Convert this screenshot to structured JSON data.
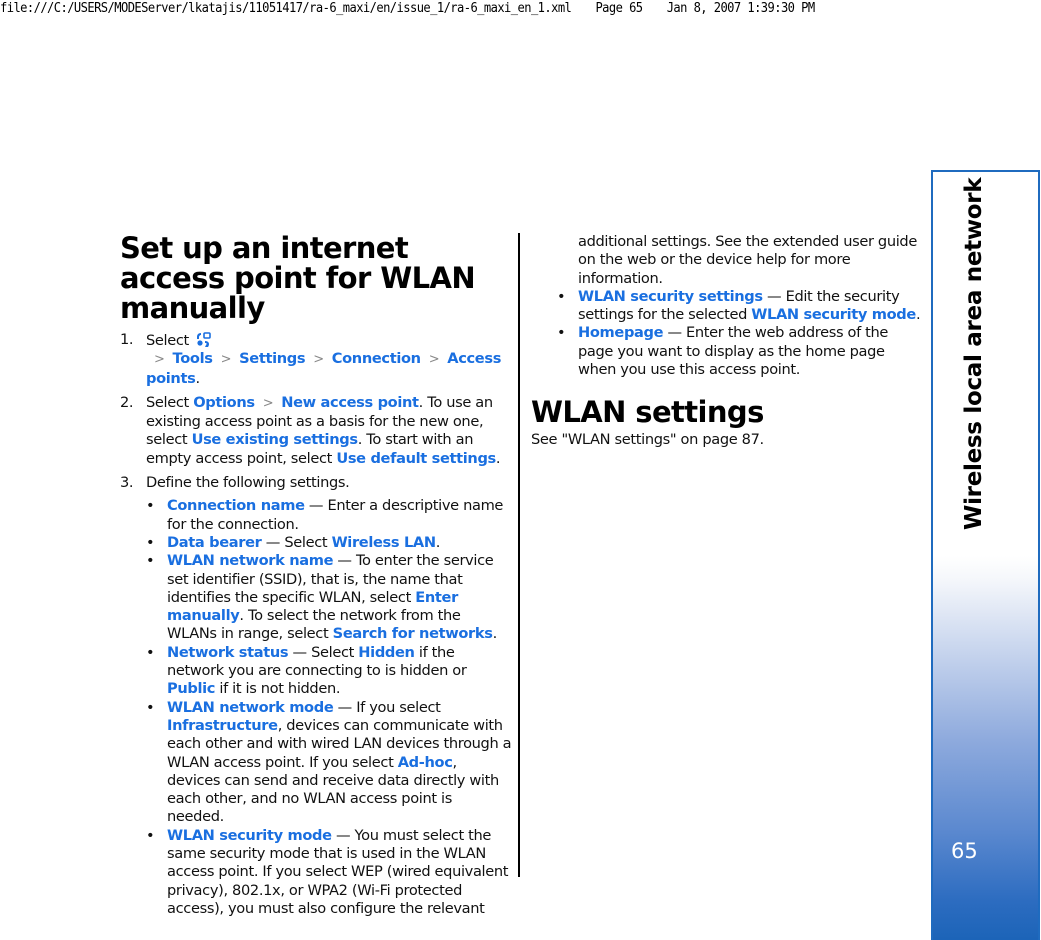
{
  "print_header": {
    "path": "file:///C:/USERS/MODEServer/lkatajis/11051417/ra-6_maxi/en/issue_1/ra-6_maxi_en_1.xml",
    "page": "Page 65",
    "datetime": "Jan 8, 2007 1:39:30 PM"
  },
  "section_tab": {
    "title": "Wireless local area network",
    "page_number": "65",
    "accent_color": "#1f6bbf"
  },
  "link_color": "#1a6fe0",
  "left": {
    "heading": "Set up an internet access point for WLAN manually",
    "step1": {
      "num": "1.",
      "select": "Select",
      "icon": "menu-apps-icon",
      "path": [
        "Tools",
        "Settings",
        "Connection",
        "Access points"
      ],
      "end": "."
    },
    "step2": {
      "num": "2.",
      "select": "Select",
      "path": [
        "Options",
        "New access point"
      ],
      "t1": ". To use an existing access point as a basis for the new one, select",
      "l1": "Use existing settings",
      "t2": ". To start with an empty access point, select",
      "l2": "Use default settings",
      "t3": "."
    },
    "step3": {
      "num": "3.",
      "text": "Define the following settings."
    },
    "bullets": [
      {
        "term": "Connection name",
        "text": " — Enter a descriptive name for the connection."
      },
      {
        "term": "Data bearer",
        "text": " — Select ",
        "l1": "Wireless LAN",
        "t2": "."
      },
      {
        "term": "WLAN network name",
        "text": " — To enter the service set identifier (SSID), that is, the name that identifies the specific WLAN, select ",
        "l1": "Enter manually",
        "t2": ". To select the network from the WLANs in range, select ",
        "l2": "Search for networks",
        "t3": "."
      },
      {
        "term": "Network status",
        "text": " — Select ",
        "l1": "Hidden",
        "t2": " if the network you are connecting to is hidden or ",
        "l2": "Public",
        "t3": " if it is not hidden."
      },
      {
        "term": "WLAN network mode",
        "text": " — If you select ",
        "l1": "Infrastructure",
        "t2": ", devices can communicate with each other and with wired LAN devices through a WLAN access point. If you select ",
        "l2": "Ad-hoc",
        "t3": ", devices can send and receive data directly with each other, and no WLAN access point is needed."
      },
      {
        "term": "WLAN security mode",
        "text": " — You must select the same security mode that is used in the WLAN access point. If you select WEP (wired equivalent privacy), 802.1x, or WPA2 (Wi-Fi protected access), you must also configure the relevant"
      }
    ],
    "bullet_char": "•",
    "separator": ">"
  },
  "right": {
    "continuation": "additional settings. See the extended user guide on the web or the device help for more information.",
    "bullets": [
      {
        "term": "WLAN security settings",
        "text": " — Edit the security settings for the selected ",
        "l1": "WLAN security mode",
        "t2": "."
      },
      {
        "term": "Homepage",
        "text": " — Enter the web address of the page you want to display as the home page when you use this access point."
      }
    ],
    "heading": "WLAN settings",
    "see_text": "See \"WLAN settings\" on page 87."
  }
}
